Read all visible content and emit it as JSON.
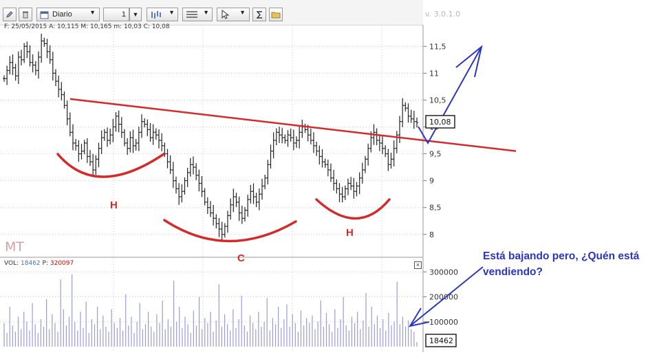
{
  "toolbar": {
    "period": "Diario",
    "count": "1",
    "version": "v. 3.0.1.0"
  },
  "info_line": "F: 25/05/2015 A: 10,115 M: 10,165 m: 10,03 C: 10,08",
  "watermark": "MT",
  "volume": {
    "prefix": "VOL:",
    "value": "18462",
    "p_label": "P:",
    "p_value": "320097",
    "last": "18462",
    "close": "×"
  },
  "annotations": {
    "h_left": "H",
    "c_center": "C",
    "h_right": "H",
    "comment": "Está bajando pero, ¿Quén está vendiendo?"
  },
  "colors": {
    "price_bars": "#222222",
    "volume_bars": "#9a9ad8",
    "neckline": "#d42a2a",
    "arrows": "#2b35c5",
    "grid": "#c8c8c8"
  },
  "chart_data": [
    {
      "type": "ohlc",
      "ylim": [
        7.6,
        11.85
      ],
      "y_ticks": [
        "11,5",
        "11",
        "10,5",
        "10",
        "9,5",
        "9",
        "8,5",
        "8"
      ],
      "y_tick_values": [
        11.5,
        11,
        10.5,
        10,
        9.5,
        9,
        8.5,
        8
      ],
      "last_value": "10,08",
      "last": 10.08,
      "neckline": {
        "start": 10.52,
        "end": 9.55
      },
      "series": [
        {
          "name": "",
          "close": [
            10.9,
            11.05,
            11.2,
            11.1,
            10.95,
            11.3,
            11.25,
            11.5,
            11.4,
            11.2,
            11.15,
            11.05,
            11.3,
            11.6,
            11.55,
            11.4,
            11.25,
            11.0,
            10.85,
            10.7,
            10.6,
            10.4,
            10.15,
            9.9,
            9.7,
            9.65,
            9.5,
            9.55,
            9.7,
            9.45,
            9.35,
            9.2,
            9.4,
            9.6,
            9.8,
            9.9,
            9.75,
            9.85,
            10.0,
            10.2,
            10.05,
            9.9,
            9.7,
            9.6,
            9.8,
            9.65,
            9.7,
            9.9,
            10.1,
            10.05,
            9.95,
            9.8,
            9.9,
            9.85,
            9.75,
            9.65,
            9.5,
            9.35,
            9.2,
            9.0,
            8.85,
            8.7,
            8.8,
            9.0,
            9.15,
            9.3,
            9.25,
            9.1,
            8.95,
            8.8,
            8.6,
            8.5,
            8.4,
            8.3,
            8.2,
            8.1,
            8.0,
            8.15,
            8.35,
            8.55,
            8.7,
            8.6,
            8.4,
            8.3,
            8.45,
            8.65,
            8.8,
            8.7,
            8.6,
            8.75,
            8.9,
            9.05,
            9.3,
            9.55,
            9.75,
            9.9,
            9.85,
            9.8,
            9.75,
            9.85,
            9.8,
            9.7,
            9.75,
            9.9,
            10.0,
            9.95,
            9.85,
            9.75,
            9.65,
            9.55,
            9.45,
            9.35,
            9.3,
            9.2,
            9.05,
            8.95,
            8.85,
            8.75,
            8.7,
            8.85,
            8.95,
            8.9,
            8.8,
            8.9,
            9.05,
            9.2,
            9.4,
            9.6,
            9.8,
            9.9,
            9.75,
            9.7,
            9.6,
            9.5,
            9.3,
            9.4,
            9.6,
            9.85,
            10.1,
            10.4,
            10.35,
            10.2,
            10.15,
            10.1,
            10.08
          ]
        }
      ]
    },
    {
      "type": "bar",
      "ylim": [
        0,
        320000
      ],
      "y_ticks": [
        "300000",
        "200000",
        "100000"
      ],
      "y_tick_values": [
        300000,
        200000,
        100000
      ],
      "series": [
        {
          "name": "VOL",
          "values": [
            95000,
            55000,
            160000,
            85000,
            60000,
            120000,
            70000,
            140000,
            100000,
            65000,
            175000,
            90000,
            55000,
            110000,
            80000,
            190000,
            70000,
            130000,
            95000,
            60000,
            270000,
            150000,
            85000,
            120000,
            290000,
            100000,
            65000,
            140000,
            75000,
            180000,
            55000,
            110000,
            90000,
            160000,
            70000,
            125000,
            80000,
            60000,
            150000,
            95000,
            75000,
            115000,
            65000,
            210000,
            85000,
            120000,
            55000,
            100000,
            175000,
            70000,
            90000,
            140000,
            80000,
            60000,
            130000,
            95000,
            185000,
            70000,
            110000,
            80000,
            265000,
            100000,
            160000,
            75000,
            120000,
            90000,
            55000,
            145000,
            85000,
            200000,
            70000,
            115000,
            95000,
            140000,
            60000,
            105000,
            250000,
            80000,
            130000,
            90000,
            65000,
            150000,
            75000,
            110000,
            205000,
            85000,
            60000,
            125000,
            95000,
            70000,
            140000,
            80000,
            100000,
            195000,
            65000,
            115000,
            90000,
            160000,
            75000,
            110000,
            170000,
            80000,
            130000,
            95000,
            60000,
            145000,
            85000,
            115000,
            95000,
            125000,
            70000,
            100000,
            185000,
            80000,
            135000,
            90000,
            60000,
            150000,
            75000,
            110000,
            200000,
            85000,
            65000,
            120000,
            95000,
            140000,
            70000,
            105000,
            215000,
            80000,
            160000,
            90000,
            125000,
            75000,
            110000,
            65000,
            135000,
            85000,
            100000,
            260000,
            90000,
            120000,
            80000,
            105000,
            70000,
            60000,
            18462
          ]
        }
      ]
    }
  ]
}
